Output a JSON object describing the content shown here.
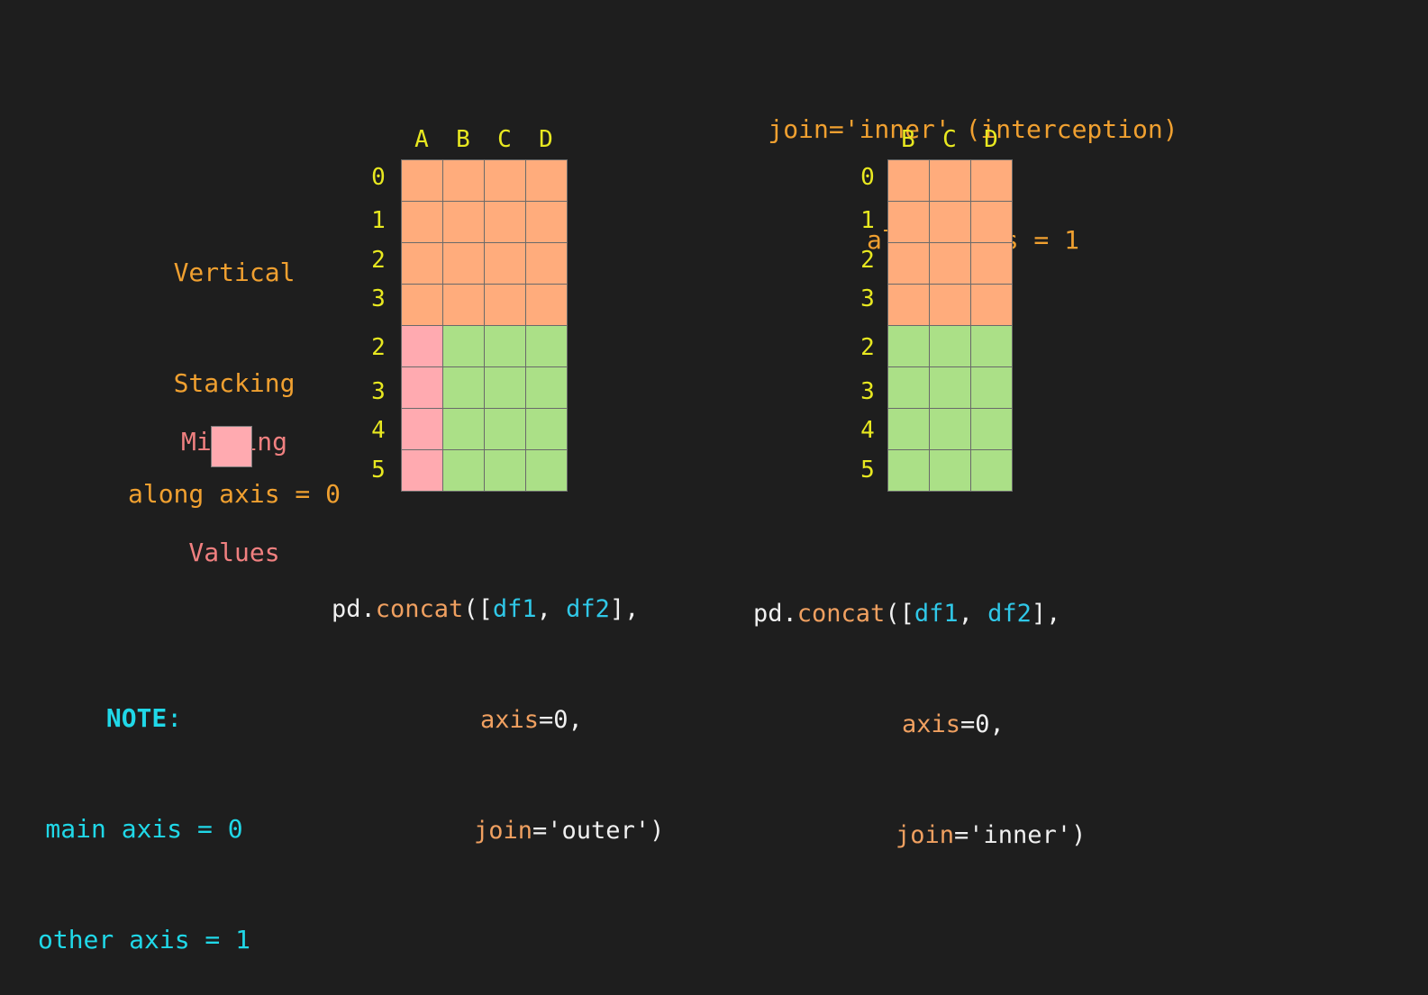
{
  "left_panel": {
    "label_lines": [
      "Vertical",
      "Stacking",
      "along axis = 0"
    ],
    "missing_lines": [
      "Missing",
      "Values"
    ],
    "note_title": "NOTE",
    "note_colon": ":",
    "note_lines": [
      "main axis = 0",
      "other axis = 1"
    ]
  },
  "left_table": {
    "columns": [
      "A",
      "B",
      "C",
      "D"
    ],
    "row_labels": [
      "0",
      "1",
      "2",
      "3",
      "2",
      "3",
      "4",
      "5"
    ],
    "code": {
      "fn_prefix": "pd.",
      "fn_name": "concat",
      "open": "([",
      "arg1": "df1",
      "comma": ", ",
      "arg2": "df2",
      "close_list": "],",
      "axis_kw": "axis",
      "axis_val": "=0,",
      "join_kw": "join",
      "join_val": "='outer')"
    }
  },
  "right_panel": {
    "title_lines": [
      "join='inner' (interception)",
      "along axis = 1"
    ]
  },
  "right_table": {
    "columns": [
      "B",
      "C",
      "D"
    ],
    "row_labels": [
      "0",
      "1",
      "2",
      "3",
      "2",
      "3",
      "4",
      "5"
    ],
    "code": {
      "fn_prefix": "pd.",
      "fn_name": "concat",
      "open": "([",
      "arg1": "df1",
      "comma": ", ",
      "arg2": "df2",
      "close_list": "],",
      "axis_kw": "axis",
      "axis_val": "=0,",
      "join_kw": "join",
      "join_val": "='inner')"
    }
  },
  "colors": {
    "background": "#1e1e1e",
    "df1_cell": "#ffac7c",
    "df2_cell": "#abe087",
    "missing_cell": "#ffaab0",
    "header_text": "#e8e820",
    "label_text": "#f0a030",
    "note_text": "#20d8e8"
  }
}
